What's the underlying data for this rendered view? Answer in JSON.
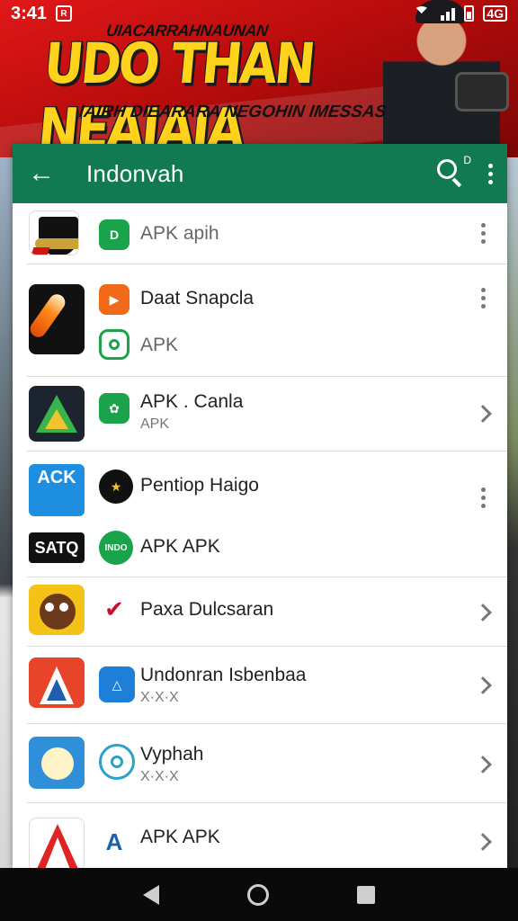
{
  "status_bar": {
    "time": "3:41",
    "notification_glyph": "R",
    "badge": "4G"
  },
  "banner": {
    "tagline": "UIACARRAHNAUNAN",
    "headline": "UDO THAN NEAIAIA",
    "subline": "IAIRH DIEARARA NEGOHIN IMESSAS"
  },
  "app_bar": {
    "title": "Indonvah",
    "search_superscript": "D",
    "color": "#117a52"
  },
  "items": [
    {
      "label": "APK apih",
      "sub": "",
      "trailing": "menu"
    },
    {
      "label": "Daat Snapcla",
      "sub": "",
      "trailing": "menu",
      "extra_label": "APK"
    },
    {
      "label": "APK . Canla",
      "sub": "APK",
      "trailing": "chevron"
    },
    {
      "label": "Pentiop Haigo",
      "sub": "",
      "trailing": "menu",
      "extra_label": "APK APK",
      "big_icon_text": "ACK",
      "small_big_icon_text": "SATQ"
    },
    {
      "label": "Paxa Dulcsaran",
      "sub": "",
      "trailing": "chevron"
    },
    {
      "label": "Undonran Isbenbaa",
      "sub": "X·X·X",
      "trailing": "chevron"
    },
    {
      "label": "Vyphah",
      "sub": "X·X·X",
      "trailing": "chevron"
    },
    {
      "label": "APK APK",
      "sub": "",
      "trailing": "chevron"
    }
  ],
  "icons": {
    "small_1": "D",
    "small_4": "INDO"
  }
}
